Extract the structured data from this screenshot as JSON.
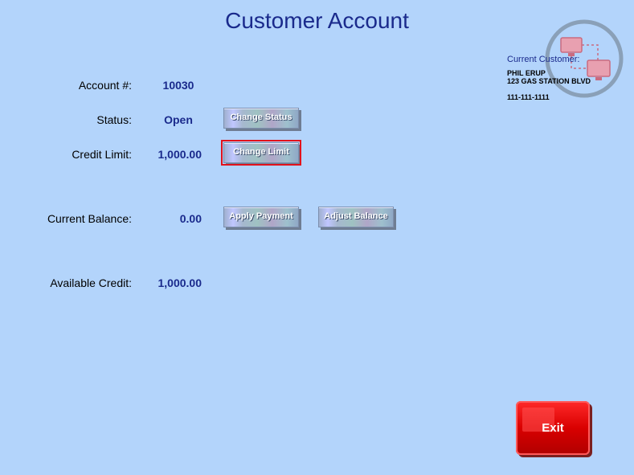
{
  "header": {
    "title": "Customer Account"
  },
  "account": {
    "number_label": "Account #:",
    "number_value": "10030",
    "status_label": "Status:",
    "status_value": "Open",
    "credit_limit_label": "Credit Limit:",
    "credit_limit_value": "1,000.00",
    "current_balance_label": "Current Balance:",
    "current_balance_value": "0.00",
    "available_credit_label": "Available Credit:",
    "available_credit_value": "1,000.00"
  },
  "buttons": {
    "change_status": "Change Status",
    "change_limit": "Change Limit",
    "apply_payment": "Apply Payment",
    "adjust_balance": "Adjust Balance",
    "exit": "Exit"
  },
  "customer": {
    "label": "Current Customer:",
    "name": "PHIL ERUP",
    "address": "123 GAS STATION BLVD",
    "phone": "111-111-1111"
  },
  "colors": {
    "background": "#b3d4fb",
    "title": "#1a2a8c",
    "exit": "#d90000",
    "selected_outline": "#e2121b"
  },
  "icons": {
    "logo": "networked-computers-icon"
  }
}
